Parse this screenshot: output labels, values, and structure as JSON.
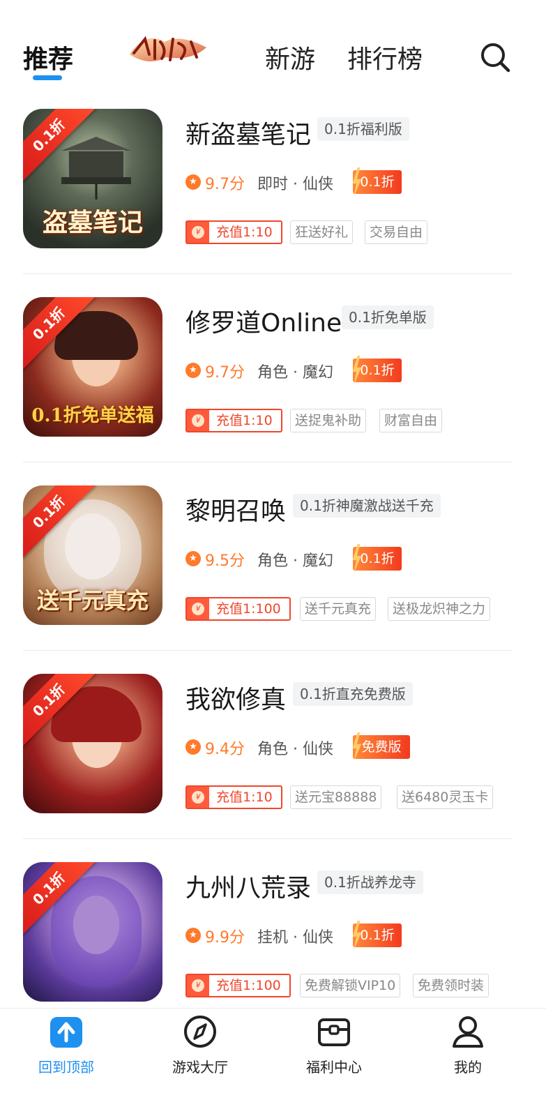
{
  "top_nav": {
    "tabs": [
      {
        "label": "推荐",
        "active": true
      },
      {
        "label": "新游"
      },
      {
        "label": "排行榜"
      }
    ],
    "accent_color": "#1e90f0"
  },
  "games": [
    {
      "title": "新盗墓笔记",
      "edition": "0.1折福利版",
      "score": "9.7分",
      "genre": "即时 · 仙侠",
      "discount": "0.1折",
      "recharge": "充值1:10",
      "tags": [
        "狂送好礼",
        "交易自由"
      ],
      "thumb_ribbon": "0.1折",
      "thumb_caption": "盗墓笔记"
    },
    {
      "title": "修罗道Online",
      "edition": "0.1折免单版",
      "score": "9.7分",
      "genre": "角色 · 魔幻",
      "discount": "0.1折",
      "recharge": "充值1:10",
      "tags": [
        "送捉鬼补助",
        "财富自由"
      ],
      "thumb_ribbon": "0.1折",
      "thumb_caption": "0.1折免单送福"
    },
    {
      "title": "黎明召唤",
      "edition": "0.1折神魔激战送千充",
      "score": "9.5分",
      "genre": "角色 · 魔幻",
      "discount": "0.1折",
      "recharge": "充值1:100",
      "tags": [
        "送千元真充",
        "送极龙炽神之力"
      ],
      "thumb_ribbon": "0.1折",
      "thumb_caption": "送千元真充"
    },
    {
      "title": "我欲修真",
      "edition": "0.1折直充免费版",
      "score": "9.4分",
      "genre": "角色 · 仙侠",
      "discount": "免费版",
      "recharge": "充值1:10",
      "tags": [
        "送元宝88888",
        "送6480灵玉卡"
      ],
      "thumb_ribbon": "0.1折",
      "thumb_caption": ""
    },
    {
      "title": "九州八荒录",
      "edition": "0.1折战养龙寺",
      "score": "9.9分",
      "genre": "挂机 · 仙侠",
      "discount": "0.1折",
      "recharge": "充值1:100",
      "tags": [
        "免费解锁VIP10",
        "免费领时装"
      ],
      "thumb_ribbon": "0.1折",
      "thumb_caption": ""
    }
  ],
  "bottom_nav": [
    {
      "label": "回到顶部",
      "icon": "arrow-up-icon",
      "active": true
    },
    {
      "label": "游戏大厅",
      "icon": "compass-icon"
    },
    {
      "label": "福利中心",
      "icon": "gift-box-icon"
    },
    {
      "label": "我的",
      "icon": "user-icon"
    }
  ],
  "colors": {
    "score": "#ff7a2a",
    "recharge": "#f0462b",
    "divider": "#e9e9e9"
  }
}
